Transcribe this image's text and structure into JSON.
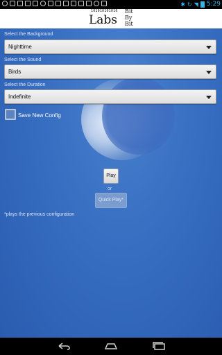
{
  "status_bar": {
    "time": "5:29",
    "left_icons": [
      "chat-icon",
      "gmail-icon",
      "image-icon",
      "video-icon",
      "play-store-icon",
      "block-icon",
      "music-icon",
      "download-icon",
      "download-icon",
      "download-icon",
      "download-icon",
      "download-icon",
      "android-icon",
      "shield-icon"
    ],
    "right_icons": [
      "bluetooth-icon",
      "rotate-icon",
      "wifi-icon",
      "battery-icon"
    ],
    "accent": "#33b5e5"
  },
  "logo": {
    "binary": "101010101010",
    "word": "Labs",
    "stack": [
      "Bit",
      "By",
      "Bit"
    ]
  },
  "form": {
    "background": {
      "label": "Select the Background",
      "value": "Nighttime"
    },
    "sound": {
      "label": "Select the Sound",
      "value": "Birds"
    },
    "duration": {
      "label": "Select the Duration",
      "value": "Indefinite"
    },
    "save_config_label": "Save New Config",
    "save_config_checked": false
  },
  "actions": {
    "play_label": "Play",
    "or_label": "or",
    "quick_play_label": "Quick Play*",
    "footnote": "*plays the previous configuration"
  },
  "nav": [
    "back-icon",
    "home-icon",
    "recent-apps-icon"
  ]
}
